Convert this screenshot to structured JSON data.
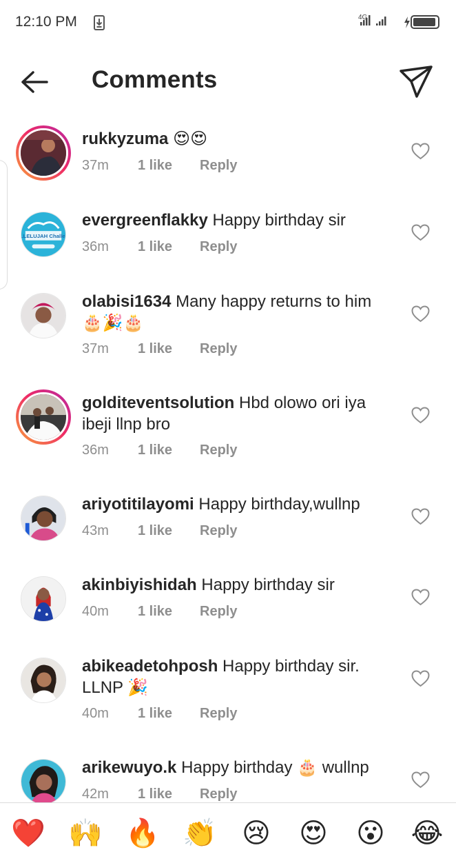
{
  "status_bar": {
    "time": "12:10 PM",
    "network": "4G"
  },
  "header": {
    "title": "Comments"
  },
  "comments": [
    {
      "username": "rukkyzuma",
      "text": "😍😍",
      "time": "37m",
      "likes": "1 like",
      "reply": "Reply"
    },
    {
      "username": "evergreenflakky",
      "text": "Happy birthday sir",
      "time": "36m",
      "likes": "1 like",
      "reply": "Reply"
    },
    {
      "username": "olabisi1634",
      "text": "Many happy returns to him 🎂🎉🎂",
      "time": "37m",
      "likes": "1 like",
      "reply": "Reply"
    },
    {
      "username": "golditeventsolution",
      "text": "Hbd olowo ori iya ibeji  llnp bro",
      "time": "36m",
      "likes": "1 like",
      "reply": "Reply"
    },
    {
      "username": "ariyotitilayomi",
      "text": "Happy birthday,wullnp",
      "time": "43m",
      "likes": "1 like",
      "reply": "Reply"
    },
    {
      "username": "akinbiyishidah",
      "text": "Happy birthday sir",
      "time": "40m",
      "likes": "1 like",
      "reply": "Reply"
    },
    {
      "username": "abikeadetohposh",
      "text": "Happy birthday sir. LLNP 🎉",
      "time": "40m",
      "likes": "1 like",
      "reply": "Reply"
    },
    {
      "username": "arikewuyo.k",
      "text": "Happy birthday 🎂 wullnp",
      "time": "42m",
      "likes": "1 like",
      "reply": "Reply"
    }
  ],
  "avatar_texts": {
    "evergreenflakky": "HALLELUJAH Challenge"
  },
  "emoji_bar": [
    "❤️",
    "🙌",
    "🔥",
    "👏",
    "😢",
    "😍",
    "😮",
    "😂"
  ],
  "colors": {
    "ring_start": "#f9a13a",
    "ring_end": "#b628a3",
    "muted": "#8e8e8e",
    "text": "#262626"
  }
}
